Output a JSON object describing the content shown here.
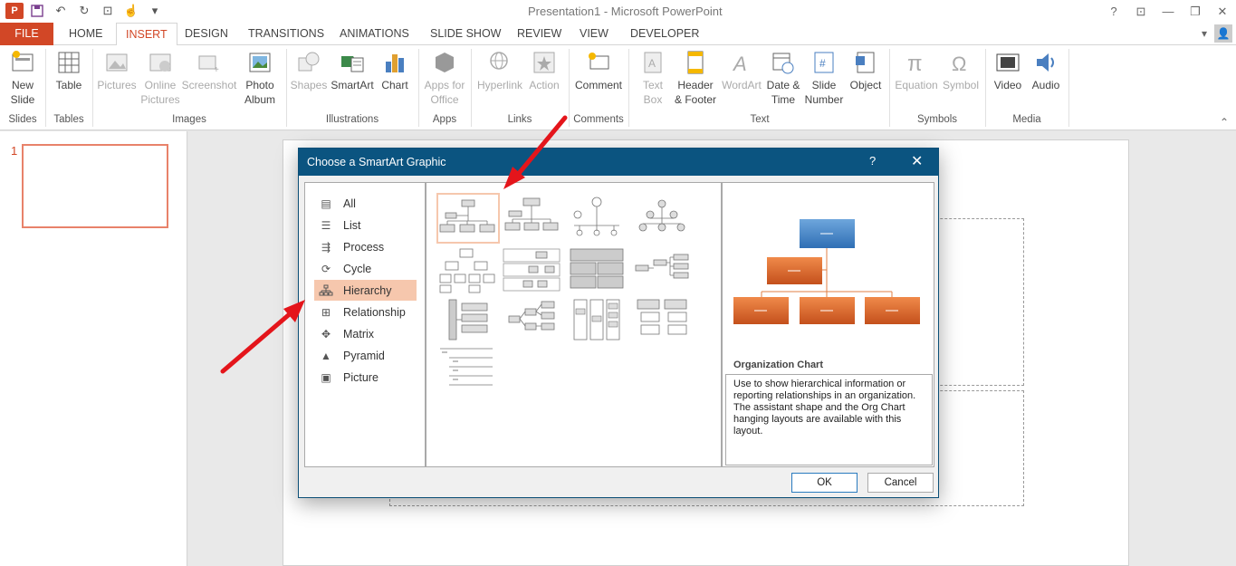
{
  "window": {
    "title": "Presentation1 - Microsoft PowerPoint",
    "app_letter": "P"
  },
  "tabs": [
    {
      "label": "FILE"
    },
    {
      "label": "HOME"
    },
    {
      "label": "INSERT"
    },
    {
      "label": "DESIGN"
    },
    {
      "label": "TRANSITIONS"
    },
    {
      "label": "ANIMATIONS"
    },
    {
      "label": "SLIDE SHOW"
    },
    {
      "label": "REVIEW"
    },
    {
      "label": "VIEW"
    },
    {
      "label": "DEVELOPER"
    }
  ],
  "ribbon": {
    "buttons": {
      "new_slide": "New\nSlide",
      "table": "Table",
      "pictures": "Pictures",
      "online_pictures": "Online\nPictures",
      "screenshot": "Screenshot",
      "photo_album": "Photo\nAlbum",
      "shapes": "Shapes",
      "smartart": "SmartArt",
      "chart": "Chart",
      "apps_for_office": "Apps for\nOffice",
      "hyperlink": "Hyperlink",
      "action": "Action",
      "comment": "Comment",
      "text_box": "Text\nBox",
      "header_footer": "Header\n& Footer",
      "wordart": "WordArt",
      "date_time": "Date &\nTime",
      "slide_number": "Slide\nNumber",
      "object": "Object",
      "equation": "Equation",
      "symbol": "Symbol",
      "video": "Video",
      "audio": "Audio"
    },
    "groups": {
      "slides": "Slides",
      "tables": "Tables",
      "images": "Images",
      "illustrations": "Illustrations",
      "apps": "Apps",
      "links": "Links",
      "comments": "Comments",
      "text": "Text",
      "symbols": "Symbols",
      "media": "Media"
    }
  },
  "thumbnails": {
    "slide_number": "1"
  },
  "dialog": {
    "title": "Choose a SmartArt Graphic",
    "help": "?",
    "close": "✕",
    "categories": [
      {
        "label": "All",
        "icon": "all-icon"
      },
      {
        "label": "List",
        "icon": "list-icon"
      },
      {
        "label": "Process",
        "icon": "process-icon"
      },
      {
        "label": "Cycle",
        "icon": "cycle-icon"
      },
      {
        "label": "Hierarchy",
        "icon": "hierarchy-icon"
      },
      {
        "label": "Relationship",
        "icon": "relationship-icon"
      },
      {
        "label": "Matrix",
        "icon": "matrix-icon"
      },
      {
        "label": "Pyramid",
        "icon": "pyramid-icon"
      },
      {
        "label": "Picture",
        "icon": "picture-icon"
      }
    ],
    "selected_category": "Hierarchy",
    "preview_title": "Organization Chart",
    "preview_description": "Use to show hierarchical information or reporting relationships in an organization. The assistant shape and the Org Chart hanging layouts are available with this layout.",
    "ok": "OK",
    "cancel": "Cancel"
  }
}
